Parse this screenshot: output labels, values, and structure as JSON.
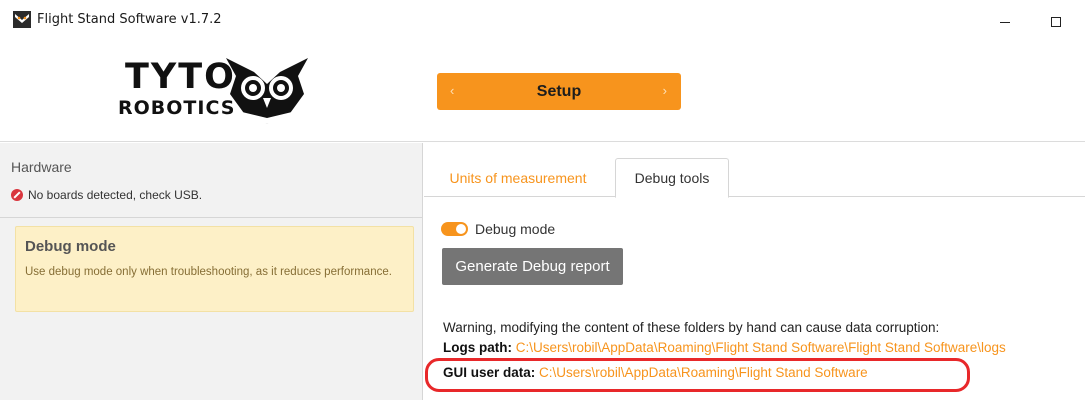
{
  "window": {
    "title": "Flight Stand Software v1.7.2"
  },
  "header": {
    "logo_line1": "TYTO",
    "logo_line2": "ROBOTICS",
    "setup_label": "Setup",
    "prev_arrow": "‹",
    "next_arrow": "›"
  },
  "sidebar": {
    "hardware_title": "Hardware",
    "hardware_status": "No boards detected, check USB.",
    "debug_card": {
      "title": "Debug mode",
      "description": "Use debug mode only when troubleshooting, as it reduces performance."
    }
  },
  "tabs": [
    {
      "label": "Units of measurement",
      "active": false
    },
    {
      "label": "Debug tools",
      "active": true
    }
  ],
  "debug": {
    "toggle_label": "Debug mode",
    "toggle_on": true,
    "generate_button": "Generate Debug report",
    "warning": "Warning, modifying the content of these folders by hand can cause data corruption:",
    "logs_label": "Logs path:",
    "logs_path": "C:\\Users\\robil\\AppData\\Roaming\\Flight Stand Software\\Flight Stand Software\\logs",
    "gui_label": "GUI user data:",
    "gui_path": "C:\\Users\\robil\\AppData\\Roaming\\Flight Stand Software"
  },
  "colors": {
    "accent": "#f7941d",
    "error": "#d9363e",
    "highlight": "#e8282a",
    "card_bg": "#fdf0c7"
  },
  "icons": [
    "app-logo-icon",
    "minimize-icon",
    "maximize-icon",
    "owl-logo-icon",
    "error-icon"
  ]
}
